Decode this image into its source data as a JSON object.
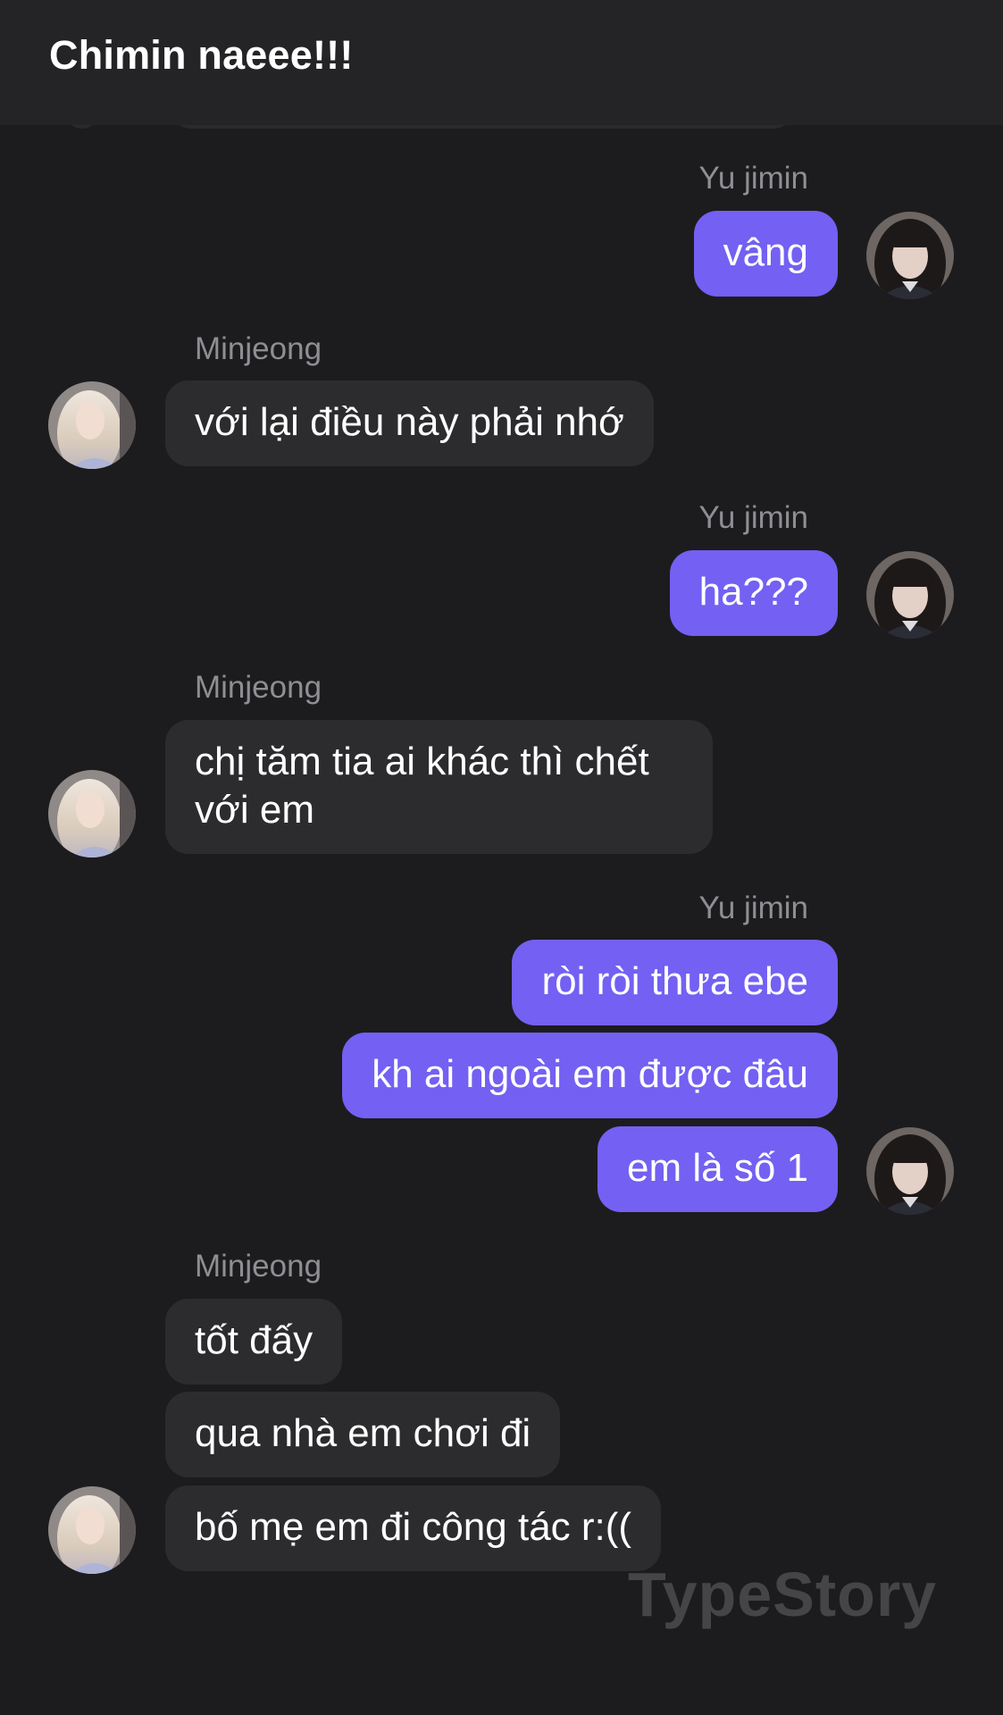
{
  "header": {
    "title": "Chimin naeee!!!"
  },
  "senders": {
    "yu": "Yu jimin",
    "min": "Minjeong"
  },
  "messages": {
    "m1": "vâng",
    "m2": "với lại điều này phải nhớ",
    "m3": "ha???",
    "m4": "chị tăm tia ai khác thì chết với em",
    "m5": "ròi ròi thưa ebe",
    "m6": "kh ai ngoài em được đâu",
    "m7": "em là số 1",
    "m8": "tốt đấy",
    "m9": "qua nhà em chơi đi",
    "m10": "bố mẹ em đi công tác r:(("
  },
  "watermark": "TypeStory",
  "colors": {
    "background": "#1c1c1e",
    "header": "#242426",
    "outgoing_bubble": "#7460f2",
    "incoming_bubble": "#2c2c2e",
    "sender_name": "#8e8e93"
  }
}
